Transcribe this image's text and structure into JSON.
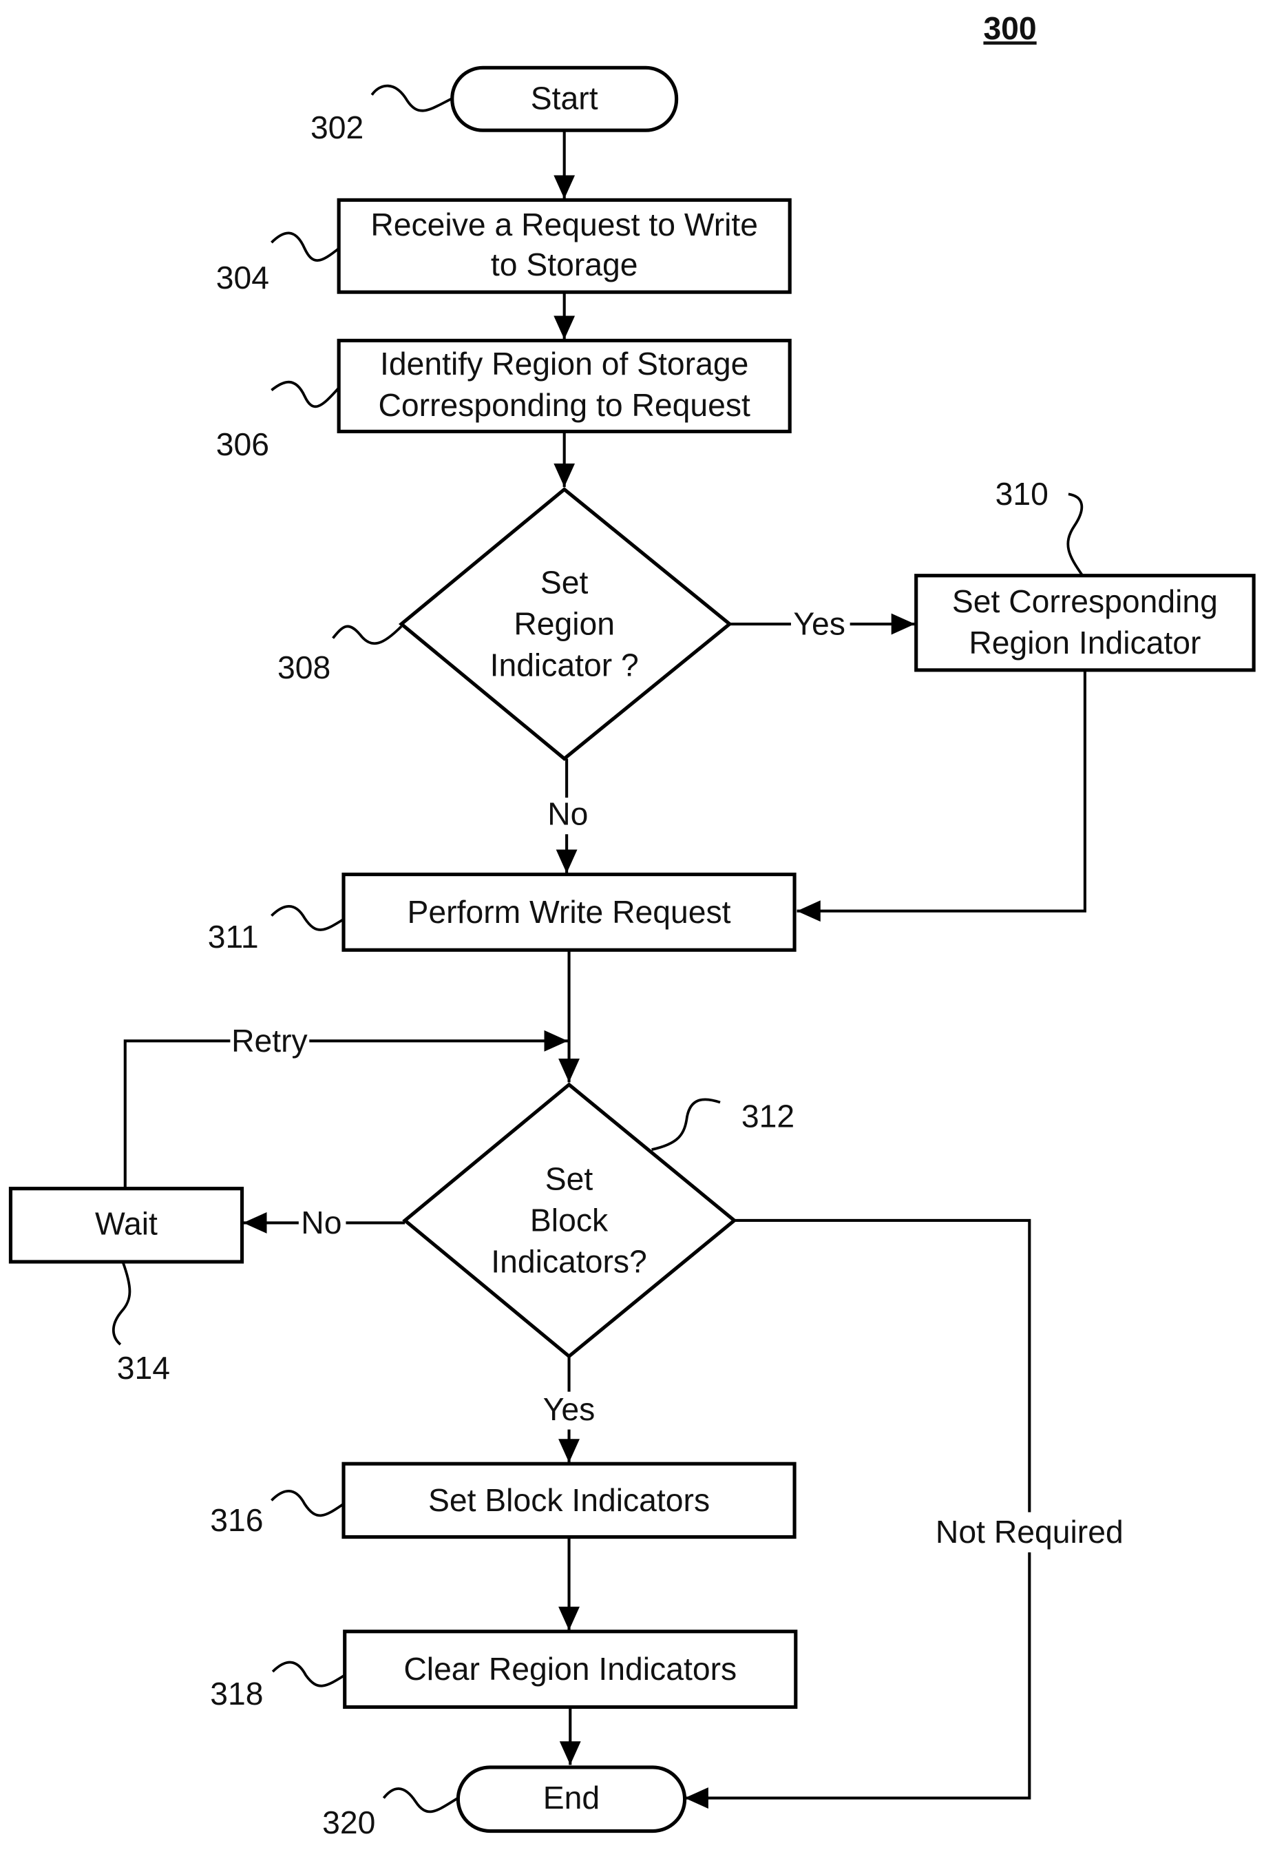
{
  "figure": {
    "number": "300"
  },
  "nodes": {
    "start": {
      "ref": "302",
      "text": [
        "Start"
      ]
    },
    "receive": {
      "ref": "304",
      "text": [
        "Receive a Request to Write",
        "to Storage"
      ]
    },
    "identify": {
      "ref": "306",
      "text": [
        "Identify Region of Storage",
        "Corresponding to Request"
      ]
    },
    "decision_region": {
      "ref": "308",
      "text": [
        "Set",
        "Region",
        "Indicator ?"
      ]
    },
    "set_region": {
      "ref": "310",
      "text": [
        "Set Corresponding",
        "Region Indicator"
      ]
    },
    "perform": {
      "ref": "311",
      "text": [
        "Perform Write Request"
      ]
    },
    "decision_block": {
      "ref": "312",
      "text": [
        "Set",
        "Block",
        "Indicators?"
      ]
    },
    "wait": {
      "ref": "314",
      "text": [
        "Wait"
      ]
    },
    "set_block": {
      "ref": "316",
      "text": [
        "Set Block Indicators"
      ]
    },
    "clear_region": {
      "ref": "318",
      "text": [
        "Clear Region Indicators"
      ]
    },
    "end": {
      "ref": "320",
      "text": [
        "End"
      ]
    }
  },
  "edge_labels": {
    "yes_308": "Yes",
    "no_308": "No",
    "retry": "Retry",
    "no_312": "No",
    "yes_312": "Yes",
    "not_required": "Not Required"
  }
}
